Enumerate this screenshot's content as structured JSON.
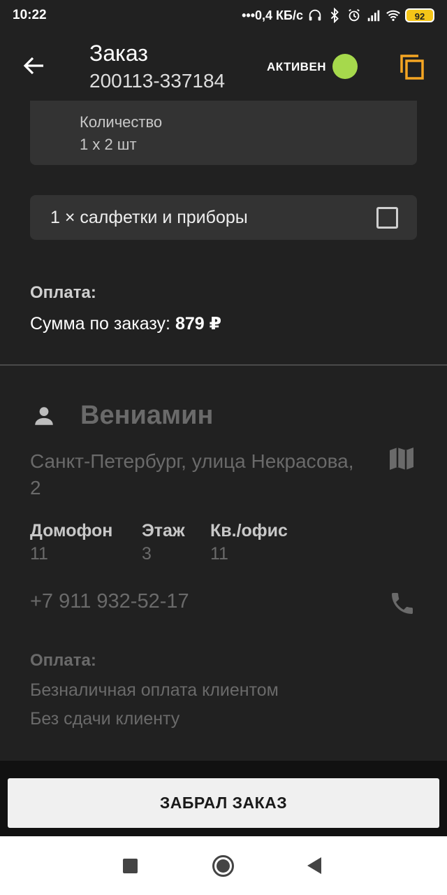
{
  "status_bar": {
    "time": "10:22",
    "net_speed": "•••0,4 КБ/с",
    "battery": "92"
  },
  "header": {
    "title": "Заказ",
    "order_number": "200113-337184",
    "status": "АКТИВЕН",
    "status_color": "#a6d94c",
    "accent_color": "#f5a623",
    "icons": [
      "back-arrow-icon",
      "copy-icon"
    ]
  },
  "order": {
    "quantity_label": "Количество",
    "quantity_value": "1 x 2 шт",
    "extra_item": "1 × салфетки и приборы",
    "extra_checked": false,
    "payment_title": "Оплата:",
    "sum_label": "Сумма по заказу:",
    "sum_value": "879 ₽"
  },
  "customer": {
    "name": "Вениамин",
    "address": "Санкт-Петербург, улица Некрасова, 2",
    "fields": [
      {
        "label": "Домофон",
        "value": "11"
      },
      {
        "label": "Этаж",
        "value": "3"
      },
      {
        "label": "Кв./офис",
        "value": "11"
      }
    ],
    "phone": "+7 911 932-52-17",
    "payment_title": "Оплата:",
    "payment_method": "Безналичная оплата клиентом",
    "change_note": "Без сдачи клиенту",
    "icons": [
      "person-icon",
      "map-icon",
      "phone-icon"
    ]
  },
  "action": {
    "button_label": "ЗАБРАЛ ЗАКАЗ"
  },
  "nav": {
    "icons": [
      "recent-apps-icon",
      "home-icon",
      "back-icon"
    ]
  }
}
